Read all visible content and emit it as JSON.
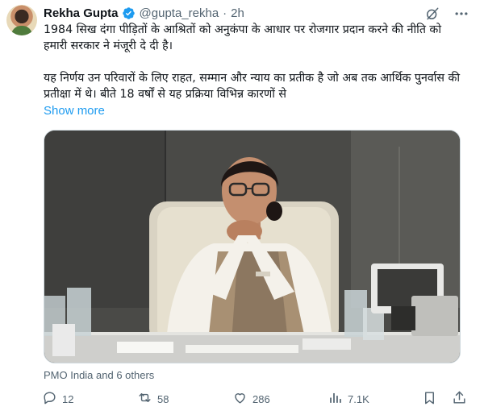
{
  "author": {
    "name": "Rekha Gupta",
    "handle": "@gupta_rekha",
    "separator": "·",
    "time": "2h"
  },
  "text": {
    "para1": "1984 सिख दंगा पीड़ितों के आश्रितों को अनुकंपा के आधार पर रोजगार प्रदान करने की नीति को हमारी सरकार ने मंजूरी दे दी है।",
    "para2": "यह निर्णय उन परिवारों के लिए राहत, सम्मान और न्याय का प्रतीक है जो अब तक आर्थिक पुनर्वास की प्रतीक्षा में थे। बीते 18 वर्षों से यह प्रक्रिया विभिन्न कारणों से",
    "show_more": "Show more"
  },
  "media": {
    "credit": "PMO India and 6 others"
  },
  "actions": {
    "replies": "12",
    "reposts": "58",
    "likes": "286",
    "views": "7.1K"
  },
  "colors": {
    "link": "#1d9bf0",
    "secondary_text": "#536471",
    "verified": "#1d9bf0"
  },
  "icons": {
    "verified": "verified-badge-icon",
    "grok": "grok-icon",
    "more": "more-icon",
    "reply": "reply-icon",
    "repost": "repost-icon",
    "like": "like-icon",
    "views": "views-icon",
    "bookmark": "bookmark-icon",
    "share": "share-icon"
  }
}
